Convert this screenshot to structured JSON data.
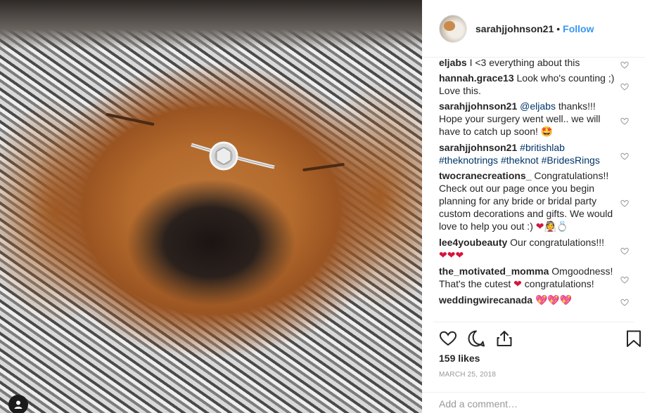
{
  "header": {
    "username": "sarahjjohnson21",
    "separator": "•",
    "follow_label": "Follow"
  },
  "comments": [
    {
      "user": "eljabs",
      "parts": [
        {
          "t": "I <3 everything about this"
        }
      ]
    },
    {
      "user": "hannah.grace13",
      "parts": [
        {
          "t": "Look who's counting ;) Love this."
        }
      ]
    },
    {
      "user": "sarahjjohnson21",
      "parts": [
        {
          "t": "@eljabs",
          "mention": true
        },
        {
          "t": " thanks!!! Hope your surgery went well.. we will have to catch up soon! "
        },
        {
          "t": "🤩",
          "emoji": true
        }
      ]
    },
    {
      "user": "sarahjjohnson21",
      "parts": [
        {
          "t": "#britishlab",
          "mention": true
        },
        {
          "t": " "
        },
        {
          "t": "#theknotrings",
          "mention": true
        },
        {
          "t": " "
        },
        {
          "t": "#theknot",
          "mention": true
        },
        {
          "t": " "
        },
        {
          "t": "#BridesRings",
          "mention": true
        }
      ]
    },
    {
      "user": "twocranecreations_",
      "parts": [
        {
          "t": "Congratulations!! Check out our page once you begin planning for any bride or bridal party custom decorations and gifts. We would love to help you out :) "
        },
        {
          "t": "❤👰💍",
          "emoji": true
        }
      ]
    },
    {
      "user": "lee4youbeauty",
      "parts": [
        {
          "t": "Our congratulations!!! "
        },
        {
          "t": "❤❤❤",
          "emoji": true
        }
      ]
    },
    {
      "user": "the_motivated_momma",
      "parts": [
        {
          "t": "Omgoodness! That's the cutest "
        },
        {
          "t": "❤",
          "emoji": true
        },
        {
          "t": " congratulations!"
        }
      ]
    },
    {
      "user": "weddingwirecanada",
      "parts": [
        {
          "t": "💖💖💖",
          "emoji": true
        }
      ]
    }
  ],
  "likes_text": "159 likes",
  "date_text": "MARCH 25, 2018",
  "add_comment_placeholder": "Add a comment…",
  "icons": {
    "like": "heart-icon",
    "comment": "comment-icon",
    "share": "share-icon",
    "save": "bookmark-icon",
    "tag": "user-tag-icon"
  },
  "colors": {
    "follow": "#3897f0",
    "mention": "#003569",
    "meta": "#999999",
    "text": "#262626"
  }
}
